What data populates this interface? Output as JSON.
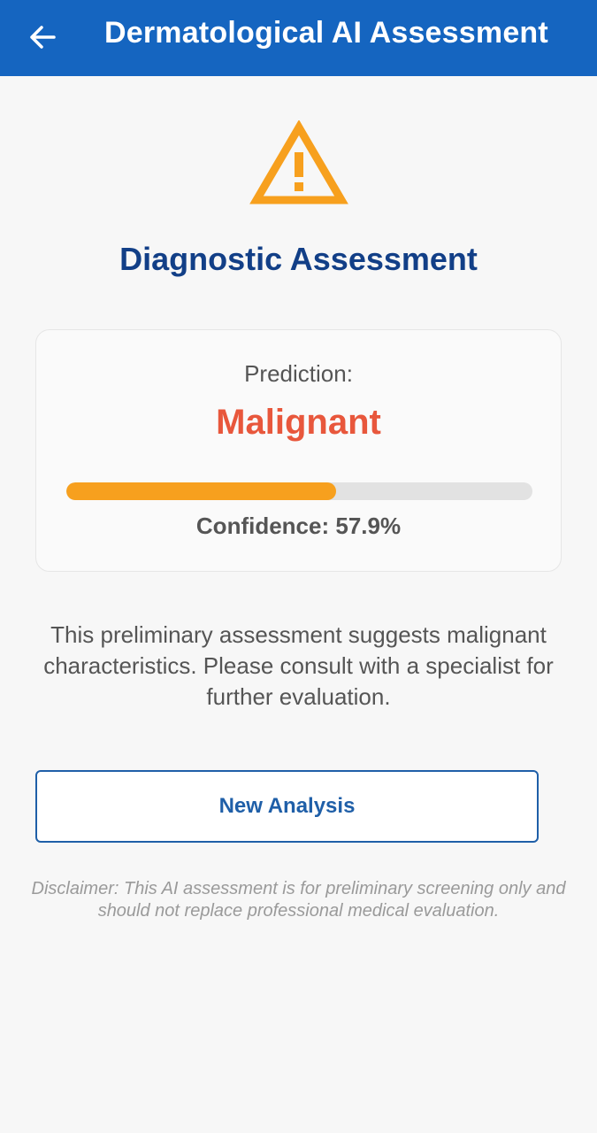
{
  "colors": {
    "app_bar": "#1565c0",
    "title_text": "#123f87",
    "prediction": "#e8573c",
    "warning": "#f7a01e",
    "button_border": "#1f5fa8"
  },
  "header": {
    "back_icon": "arrow-left-icon",
    "title": "Dermatological AI Assessment"
  },
  "status_icon": "warning-triangle-icon",
  "assessment_title": "Diagnostic Assessment",
  "result": {
    "prediction_label": "Prediction:",
    "prediction_value": "Malignant",
    "confidence_fraction": 0.579,
    "confidence_text": "Confidence: 57.9%"
  },
  "message": "This preliminary assessment suggests malignant characteristics. Please consult with a specialist for further evaluation.",
  "new_analysis_label": "New Analysis",
  "disclaimer": "Disclaimer: This AI assessment is for preliminary screening only and should not replace professional medical evaluation."
}
